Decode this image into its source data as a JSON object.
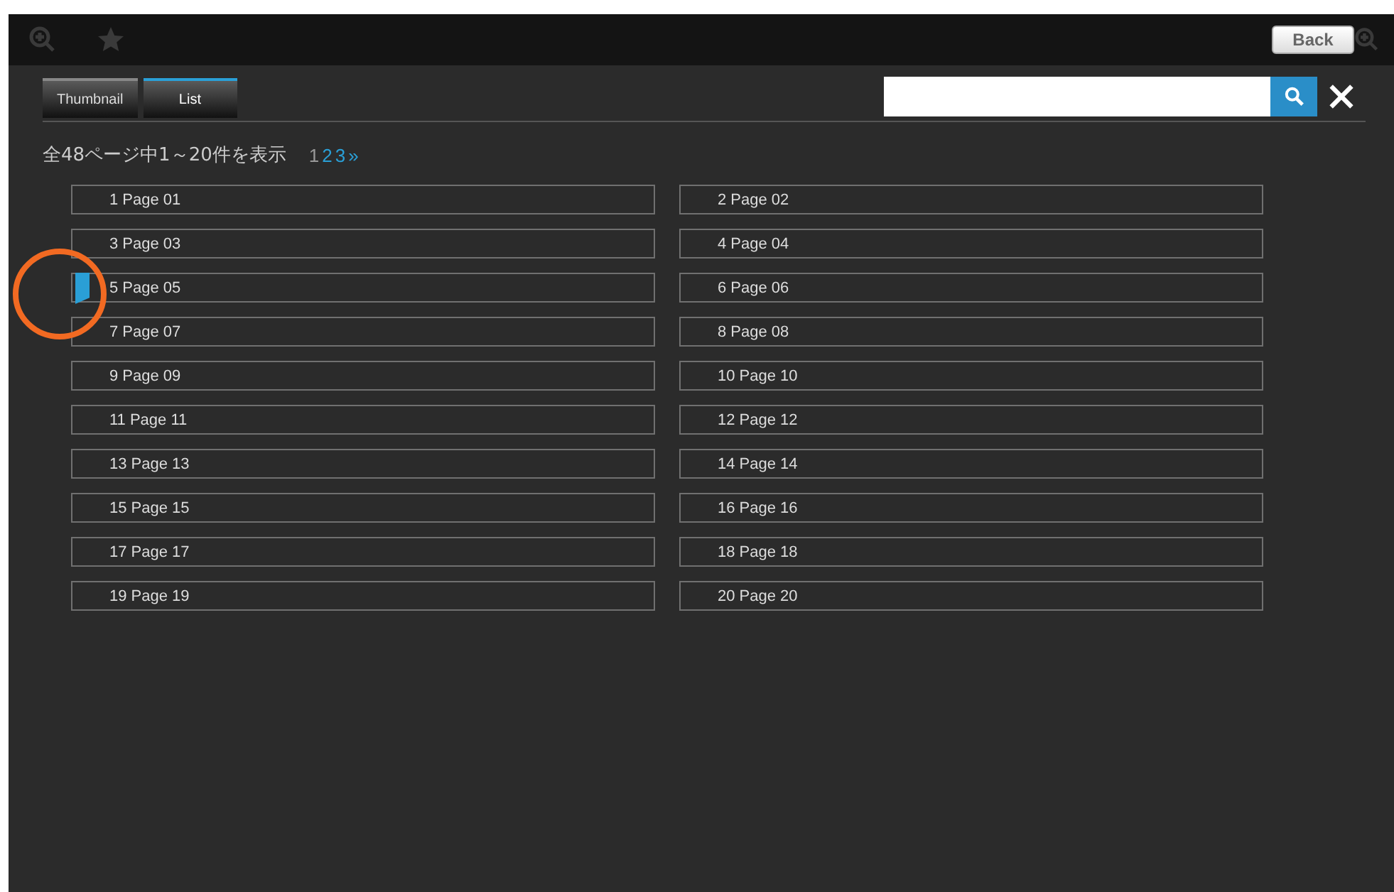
{
  "toolbar": {
    "back_label": "Back"
  },
  "tabs": [
    {
      "label": "Thumbnail",
      "selected": false
    },
    {
      "label": "List",
      "selected": true
    }
  ],
  "summary": "全48ページ中1～20件を表示",
  "pagination": [
    {
      "label": "1",
      "selected": true
    },
    {
      "label": "2",
      "selected": false
    },
    {
      "label": "3",
      "selected": false
    },
    {
      "label": "»",
      "selected": false
    }
  ],
  "pages": [
    {
      "label": "1 Page 01",
      "bookmarked": false
    },
    {
      "label": "2 Page 02",
      "bookmarked": false
    },
    {
      "label": "3 Page 03",
      "bookmarked": false
    },
    {
      "label": "4 Page 04",
      "bookmarked": false
    },
    {
      "label": "5 Page 05",
      "bookmarked": true
    },
    {
      "label": "6 Page 06",
      "bookmarked": false
    },
    {
      "label": "7 Page 07",
      "bookmarked": false
    },
    {
      "label": "8 Page 08",
      "bookmarked": false
    },
    {
      "label": "9 Page 09",
      "bookmarked": false
    },
    {
      "label": "10 Page 10",
      "bookmarked": false
    },
    {
      "label": "11 Page 11",
      "bookmarked": false
    },
    {
      "label": "12 Page 12",
      "bookmarked": false
    },
    {
      "label": "13 Page 13",
      "bookmarked": false
    },
    {
      "label": "14 Page 14",
      "bookmarked": false
    },
    {
      "label": "15 Page 15",
      "bookmarked": false
    },
    {
      "label": "16 Page 16",
      "bookmarked": false
    },
    {
      "label": "17 Page 17",
      "bookmarked": false
    },
    {
      "label": "18 Page 18",
      "bookmarked": false
    },
    {
      "label": "19 Page 19",
      "bookmarked": false
    },
    {
      "label": "20 Page 20",
      "bookmarked": false
    }
  ]
}
